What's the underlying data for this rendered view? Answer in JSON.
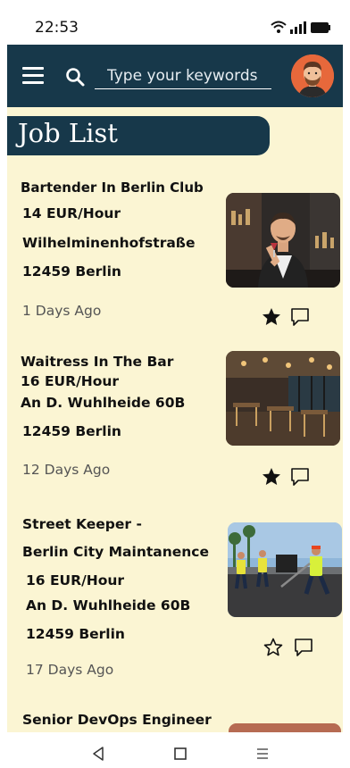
{
  "status_bar": {
    "time": "22:53",
    "icons": [
      "wifi-icon",
      "signal-icon",
      "battery-icon"
    ]
  },
  "header": {
    "search_placeholder": "Type your keywords",
    "menu_icon": "hamburger-menu-icon",
    "search_icon": "search-icon",
    "avatar": "user-avatar"
  },
  "page": {
    "title": "Job List"
  },
  "jobs": [
    {
      "lines": [
        "Bartender In Berlin Club",
        "14 EUR/Hour",
        "Wilhelminenhofstraße",
        "12459 Berlin"
      ],
      "posted": "1 Days Ago",
      "favorite": true,
      "image": "bartender-photo"
    },
    {
      "lines": [
        "Waitress In The Bar",
        "16 EUR/Hour",
        "An D. Wuhlheide 60B",
        "12459 Berlin"
      ],
      "posted": "12 Days Ago",
      "favorite": true,
      "image": "bar-interior-photo"
    },
    {
      "lines": [
        "Street Keeper -",
        "Berlin City Maintanence",
        "16 EUR/Hour",
        "An D. Wuhlheide 60B",
        "12459 Berlin"
      ],
      "posted": "17 Days Ago",
      "favorite": false,
      "image": "road-workers-photo"
    },
    {
      "lines": [
        "Senior DevOps Engineer"
      ],
      "image": "office-photo"
    }
  ],
  "nav": [
    "back-icon",
    "home-icon",
    "recents-icon"
  ],
  "colors": {
    "header": "#17384a",
    "background": "#fbf5d3",
    "avatar": "#e7683b"
  }
}
